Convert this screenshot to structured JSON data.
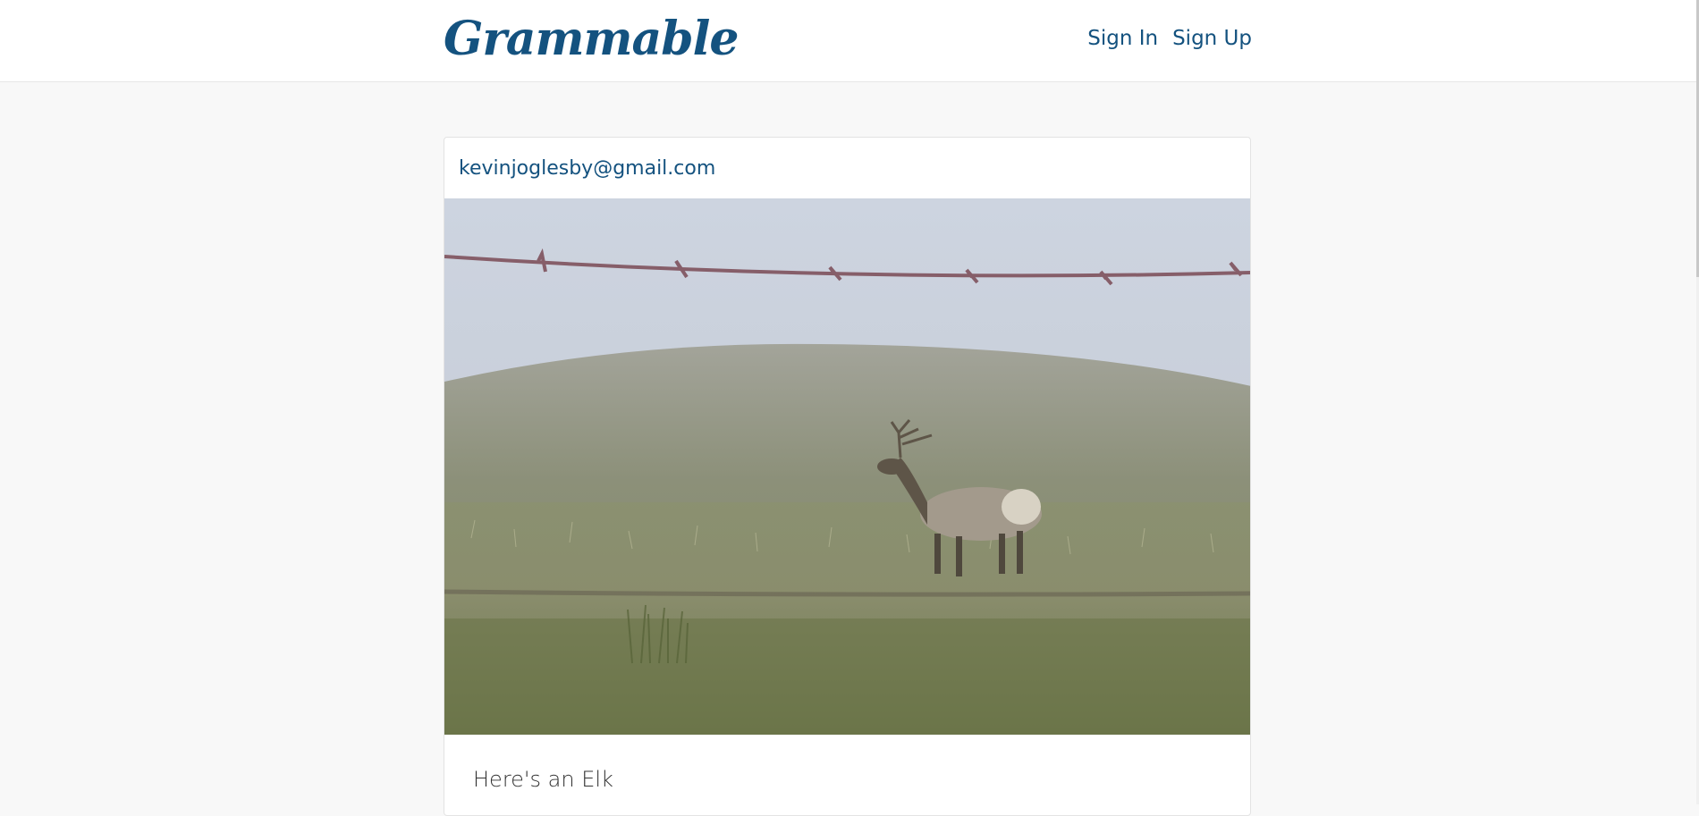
{
  "navbar": {
    "brand": "Grammable",
    "links": [
      {
        "label": "Sign In"
      },
      {
        "label": "Sign Up"
      }
    ]
  },
  "post": {
    "author_email": "kevinjoglesby@gmail.com",
    "photo_alt": "elk-in-foggy-field-photo",
    "caption": "Here's an Elk"
  },
  "colors": {
    "brand": "#14527f",
    "page_background": "#f8f8f8",
    "card_background": "#ffffff"
  }
}
